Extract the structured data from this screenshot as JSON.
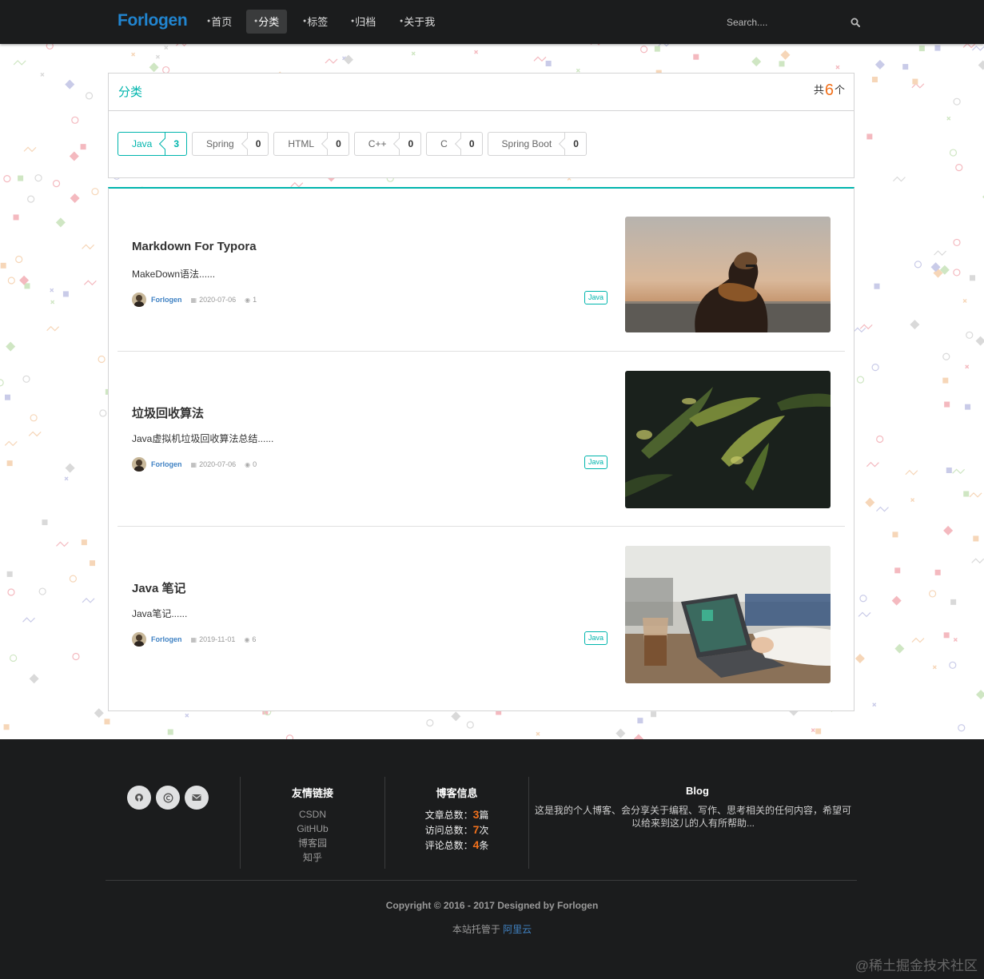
{
  "nav": {
    "logo": "Forlogen",
    "items": [
      {
        "label": "首页",
        "icon": "home-icon",
        "active": false
      },
      {
        "label": "分类",
        "icon": "idea-icon",
        "active": true
      },
      {
        "label": "标签",
        "icon": "tags-icon",
        "active": false
      },
      {
        "label": "归档",
        "icon": "clone-icon",
        "active": false
      },
      {
        "label": "关于我",
        "icon": "info-icon",
        "active": false
      }
    ],
    "search_placeholder": "Search...."
  },
  "categories": {
    "title": "分类",
    "count_prefix": "共",
    "count": "6",
    "count_suffix": "个",
    "tags": [
      {
        "name": "Java",
        "count": "3",
        "active": true
      },
      {
        "name": "Spring",
        "count": "0",
        "active": false
      },
      {
        "name": "HTML",
        "count": "0",
        "active": false
      },
      {
        "name": "C++",
        "count": "0",
        "active": false
      },
      {
        "name": "C",
        "count": "0",
        "active": false
      },
      {
        "name": "Spring Boot",
        "count": "0",
        "active": false
      }
    ]
  },
  "posts": [
    {
      "title": "Markdown For Typora",
      "desc": "MakeDown语法......",
      "author": "Forlogen",
      "date": "2020-07-06",
      "views": "1",
      "label": "Java",
      "image": "man-scarf-sunset-photo"
    },
    {
      "title": "垃圾回收算法",
      "desc": "Java虚拟机垃圾回收算法总结......",
      "author": "Forlogen",
      "date": "2020-07-06",
      "views": "0",
      "label": "Java",
      "image": "fern-leaves-photo"
    },
    {
      "title": "Java 笔记",
      "desc": "Java笔记......",
      "author": "Forlogen",
      "date": "2019-11-01",
      "views": "6",
      "label": "Java",
      "image": "laptop-coffee-photo"
    }
  ],
  "footer": {
    "links_title": "友情链接",
    "links": [
      "CSDN",
      "GitHUb",
      "博客园",
      "知乎"
    ],
    "info_title": "博客信息",
    "stats": [
      {
        "label": "文章总数：",
        "value": "3",
        "unit": "篇"
      },
      {
        "label": "访问总数：",
        "value": "7",
        "unit": "次"
      },
      {
        "label": "评论总数：",
        "value": "4",
        "unit": "条"
      }
    ],
    "blog_title": "Blog",
    "blog_text": "这是我的个人博客、会分享关于编程、写作、思考相关的任何内容，希望可以给来到这儿的人有所帮助...",
    "copyright": "Copyright © 2016 - 2017 Designed by Forlogen",
    "hosted_prefix": "本站托管于",
    "hosted_link": "阿里云",
    "watermark": "@稀土掘金技术社区"
  },
  "colors": {
    "accent": "#00b5ad",
    "brand": "#2185d0",
    "highlight": "#f2711c",
    "nav_bg": "#1b1c1d"
  }
}
